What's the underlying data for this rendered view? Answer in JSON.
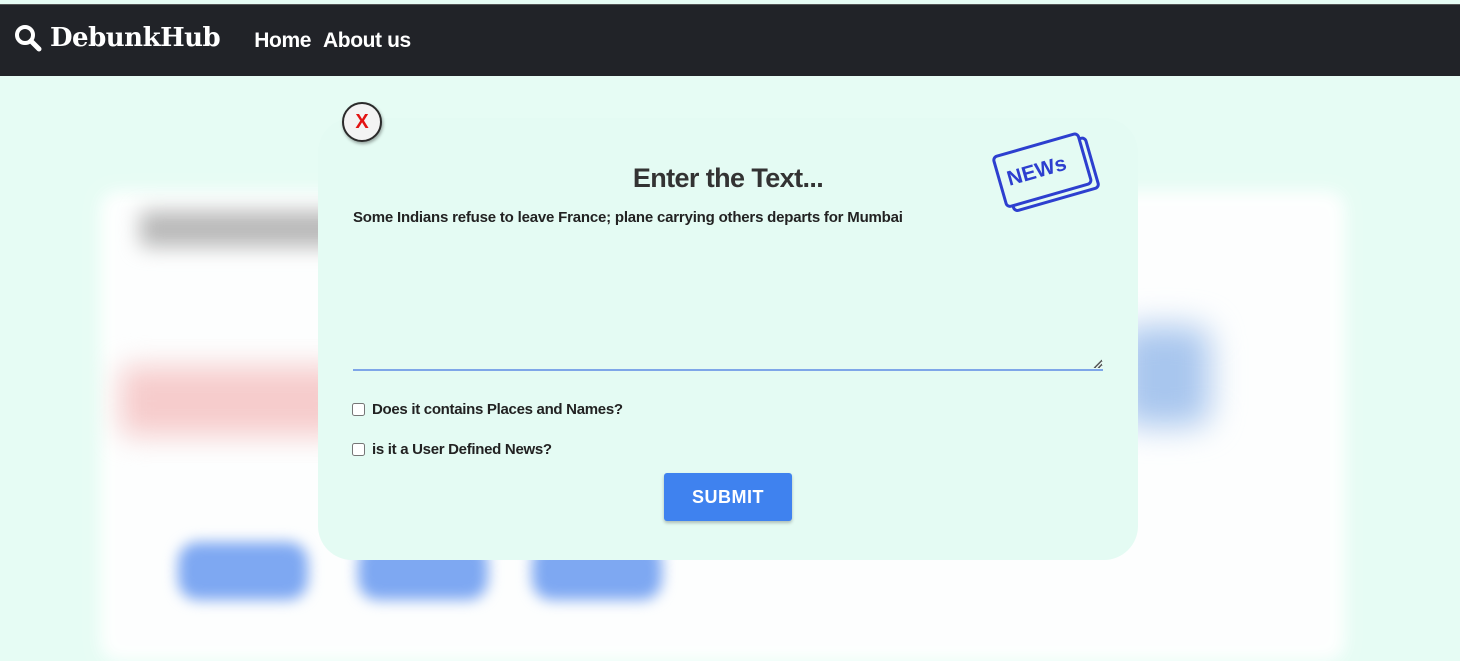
{
  "navbar": {
    "brand": "DebunkHub",
    "links": [
      "Home",
      "About us"
    ]
  },
  "modal": {
    "close_label": "X",
    "news_badge": "NEWs",
    "title": "Enter the Text...",
    "textarea_value": "Some Indians refuse to leave France; plane carrying others departs for Mumbai",
    "checkboxes": [
      {
        "label": "Does it contains Places and Names?",
        "checked": false
      },
      {
        "label": "is it a User Defined News?",
        "checked": false
      }
    ],
    "submit_label": "SUBMIT"
  },
  "colors": {
    "navbar_bg": "#212328",
    "page_bg": "#e6fcf4",
    "submit_bg": "#3f82ef",
    "close_x": "#e31212",
    "news_icon": "#2d3fcf"
  }
}
